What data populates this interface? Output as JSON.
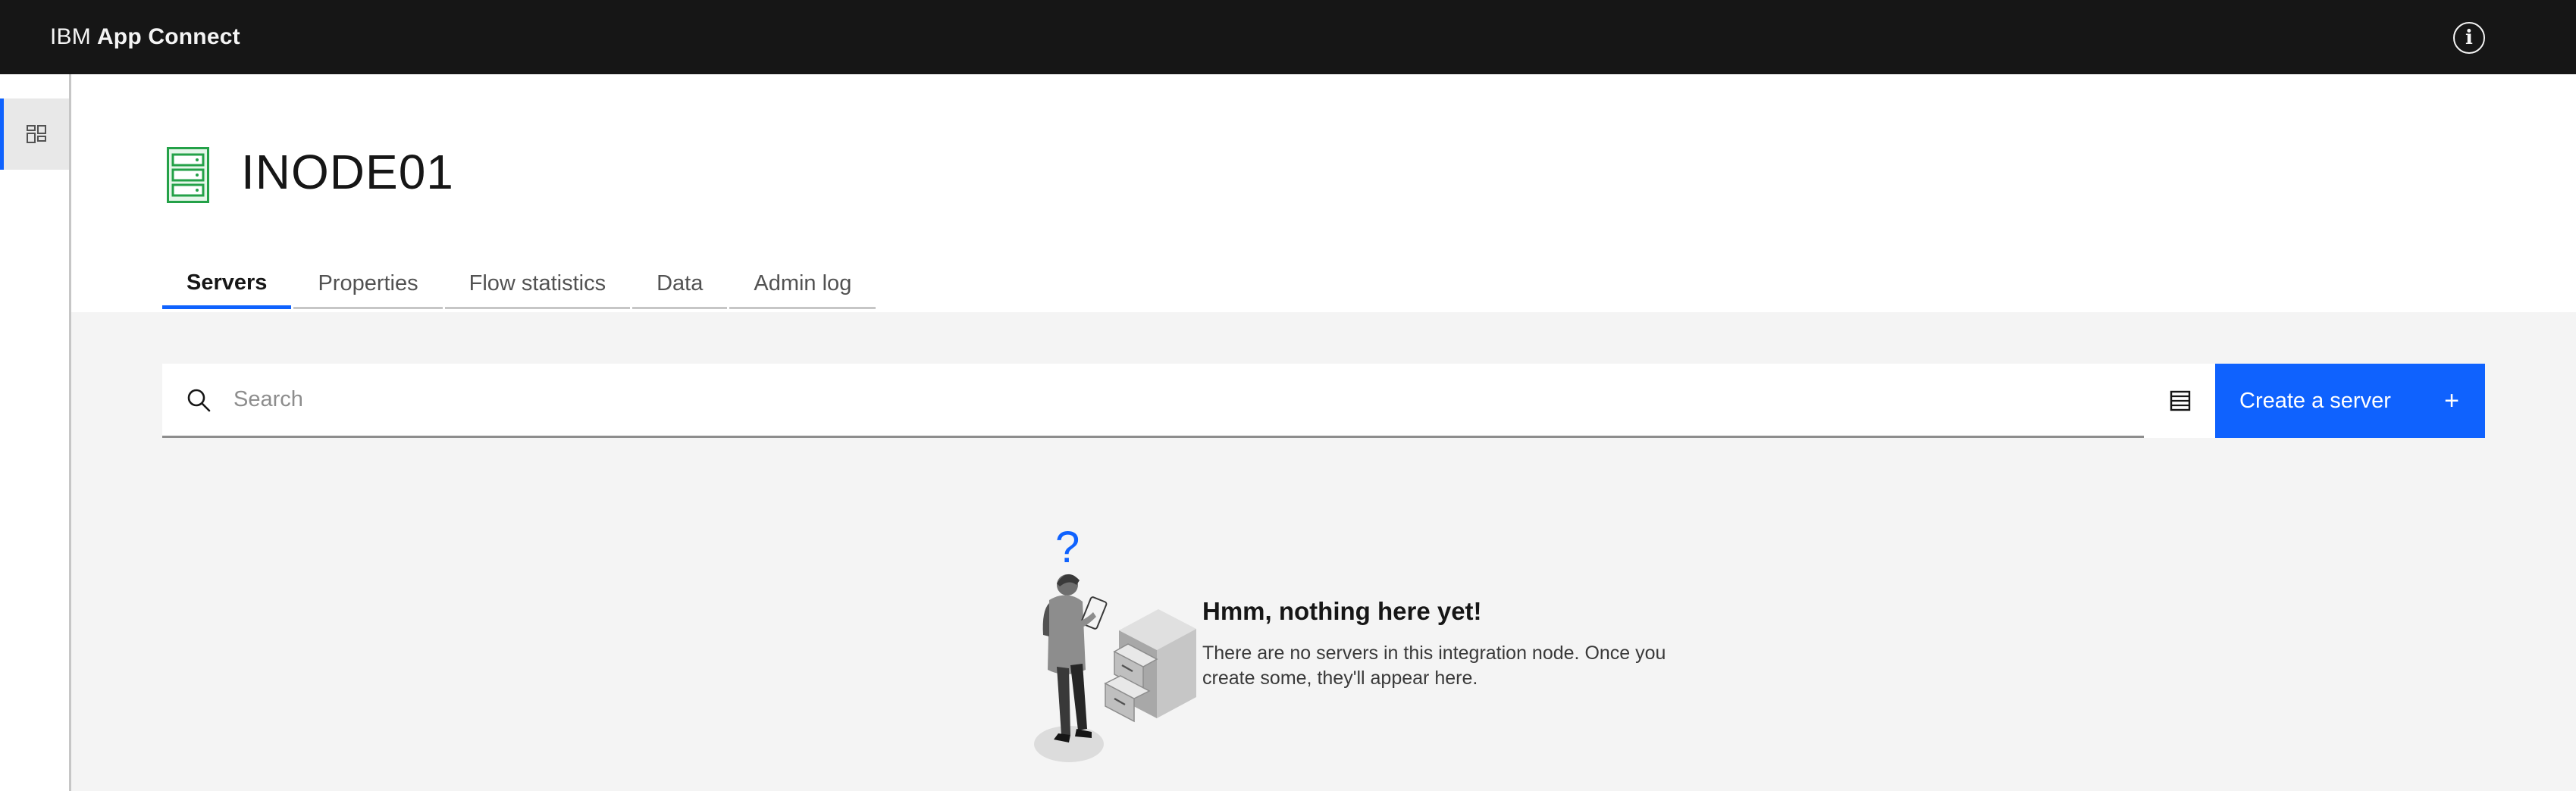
{
  "header": {
    "brand_prefix": "IBM",
    "brand_name": "App Connect",
    "info_icon": "info-icon"
  },
  "siderail": {
    "items": [
      {
        "icon": "dashboard-icon",
        "active": true
      }
    ]
  },
  "page": {
    "title": "INODE01",
    "icon": "integration-node-icon",
    "icon_color": "#24a148"
  },
  "tabs": [
    {
      "label": "Servers",
      "active": true
    },
    {
      "label": "Properties",
      "active": false
    },
    {
      "label": "Flow statistics",
      "active": false
    },
    {
      "label": "Data",
      "active": false
    },
    {
      "label": "Admin log",
      "active": false
    }
  ],
  "toolbar": {
    "search_placeholder": "Search",
    "search_value": "",
    "view_toggle_icon": "list-view-icon",
    "create_label": "Create a server",
    "create_icon": "+"
  },
  "empty_state": {
    "title": "Hmm, nothing here yet!",
    "description": "There are no servers in this integration node. Once you create some, they'll appear here.",
    "question_mark": "?"
  },
  "colors": {
    "accent": "#0f62fe",
    "header_bg": "#161616",
    "content_bg": "#f4f4f4"
  }
}
